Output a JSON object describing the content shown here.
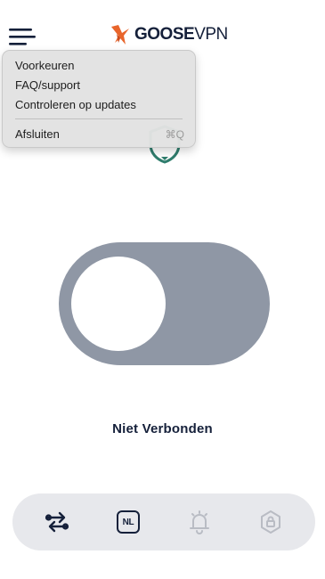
{
  "header": {
    "logo_text_bold": "GOOSE",
    "logo_text_light": "VPN"
  },
  "menu": {
    "items": [
      {
        "label": "Voorkeuren",
        "shortcut": ""
      },
      {
        "label": "FAQ/support",
        "shortcut": ""
      },
      {
        "label": "Controleren op updates",
        "shortcut": ""
      }
    ],
    "quit": {
      "label": "Afsluiten",
      "shortcut": "⌘Q"
    }
  },
  "connection": {
    "status": "Niet Verbonden",
    "connected": false
  },
  "bottom_nav": {
    "items": [
      {
        "name": "switch-protocol",
        "icon": "arrows-swap-icon"
      },
      {
        "name": "location",
        "icon": "country-badge",
        "label": "NL"
      },
      {
        "name": "notifications",
        "icon": "bell-icon"
      },
      {
        "name": "security",
        "icon": "shield-lock-icon"
      }
    ]
  },
  "colors": {
    "brand_dark": "#15203a",
    "accent_green": "#2f7d6d",
    "logo_orange": "#e8652b",
    "toggle_off": "#8f97a5",
    "nav_bg": "#e7e8ec",
    "nav_inactive_icon": "#b9bcc4"
  }
}
